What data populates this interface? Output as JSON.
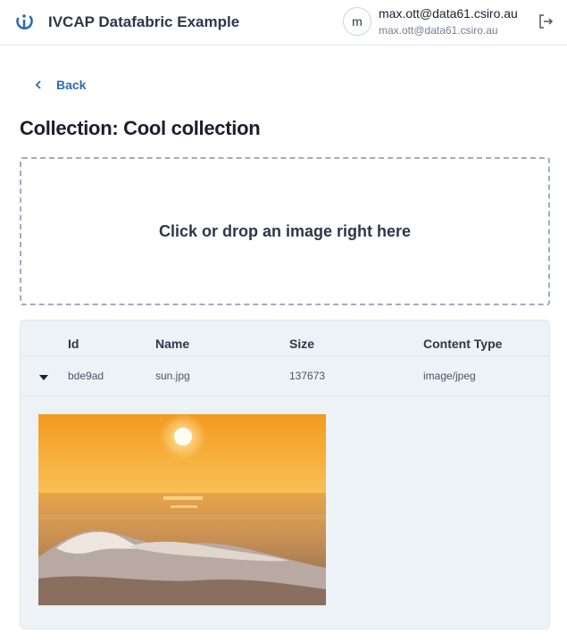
{
  "header": {
    "app_title": "IVCAP Datafabric Example",
    "avatar_initial": "m",
    "user_name": "max.ott@data61.csiro.au",
    "user_email": "max.ott@data61.csiro.au",
    "logo_icon": "ivcap-logo-icon",
    "logout_icon": "logout-icon"
  },
  "nav": {
    "back_label": "Back",
    "back_icon": "chevron-left-icon"
  },
  "page": {
    "title": "Collection: Cool collection"
  },
  "dropzone": {
    "label": "Click or drop an image right here"
  },
  "table": {
    "columns": [
      "Id",
      "Name",
      "Size",
      "Content Type"
    ],
    "rows": [
      {
        "id": "bde9ad",
        "name": "sun.jpg",
        "size": "137673",
        "content_type": "image/jpeg",
        "expanded": true
      }
    ]
  },
  "colors": {
    "accent": "#2b6cb0",
    "table_bg": "#edf2f7",
    "border": "#e2e8f0"
  }
}
